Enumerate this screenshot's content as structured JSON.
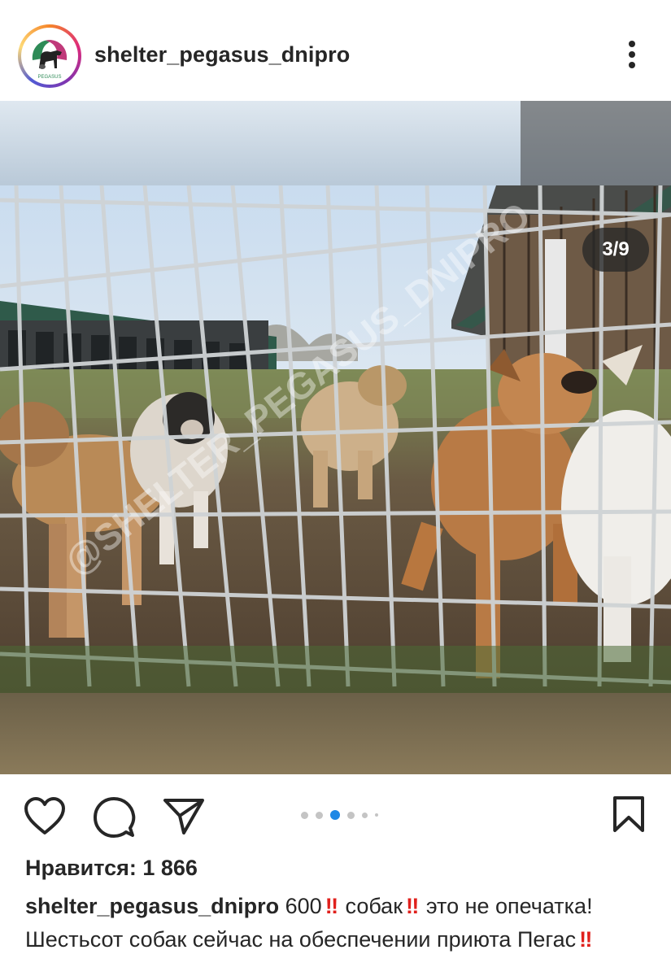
{
  "post": {
    "username": "shelter_pegasus_dnipro",
    "avatar_text": "PEGASUS",
    "slide_counter": "3/9",
    "watermark": "@SHELTER_PEGASUS_DNIPRO",
    "likes": "Нравится: 1 866",
    "caption": {
      "username": "shelter_pegasus_dnipro",
      "part1": "600",
      "part2": "собак",
      "part3": "это не опечатка! Шестьсот собак сейчас на обеспечении приюта Пегас",
      "bang": "‼"
    },
    "carousel": {
      "total_dots": 6,
      "active_index": 2
    }
  },
  "icons": {
    "more": "more-vertical-icon",
    "like": "heart-icon",
    "comment": "comment-icon",
    "share": "paper-plane-icon",
    "save": "bookmark-icon"
  },
  "colors": {
    "text": "#262626",
    "carousel_active": "#1e88e5",
    "carousel_inactive": "#c4c4c4",
    "bang": "#e0201c"
  }
}
